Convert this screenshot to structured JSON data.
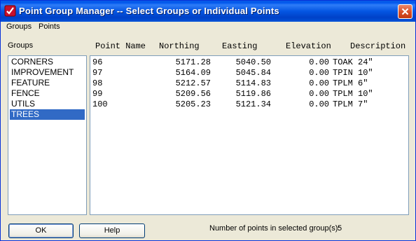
{
  "window": {
    "title": "Point Group Manager -- Select Groups or Individual Points",
    "accent_color": "#0058ee",
    "app_icon": "checkmark-app-icon",
    "close_icon": "close-icon"
  },
  "menubar": {
    "items": [
      "Groups",
      "Points"
    ]
  },
  "groups": {
    "label": "Groups",
    "items": [
      "CORNERS",
      "IMPROVEMENT",
      "FEATURE",
      "FENCE",
      "UTILS",
      "TREES"
    ],
    "selected": "TREES",
    "selection_color": "#316ac5"
  },
  "points": {
    "columns": [
      "Point Name",
      "Northing",
      "Easting",
      "Elevation",
      "Description"
    ],
    "rows": [
      {
        "name": "96",
        "northing": "5171.28",
        "easting": "5040.50",
        "elevation": "0.00",
        "description": "TOAK 24\""
      },
      {
        "name": "97",
        "northing": "5164.09",
        "easting": "5045.84",
        "elevation": "0.00",
        "description": "TPIN 10\""
      },
      {
        "name": "98",
        "northing": "5212.57",
        "easting": "5114.83",
        "elevation": "0.00",
        "description": "TPLM 6\""
      },
      {
        "name": "99",
        "northing": "5209.56",
        "easting": "5119.86",
        "elevation": "0.00",
        "description": "TPLM 10\""
      },
      {
        "name": "100",
        "northing": "5205.23",
        "easting": "5121.34",
        "elevation": "0.00",
        "description": "TPLM 7\""
      }
    ]
  },
  "footer": {
    "ok_label": "OK",
    "help_label": "Help",
    "count_label": "Number of points in selected group(s):",
    "count_value": "5"
  }
}
